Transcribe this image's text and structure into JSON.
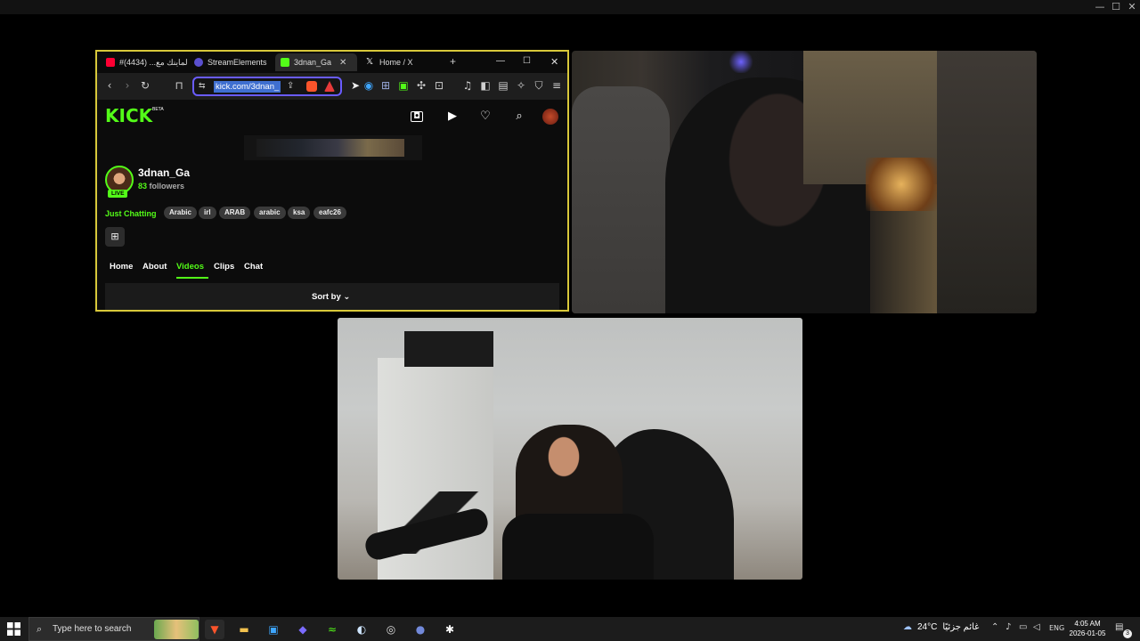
{
  "window": {
    "minimize": "—",
    "maximize": "☐",
    "close": "✕"
  },
  "browser": {
    "tabs": [
      {
        "label": "#الماينك مع... (4434)",
        "icon_color": "#ff0033",
        "icon": "youtube-icon"
      },
      {
        "label": "StreamElements",
        "icon_color": "#5a4fcf",
        "icon": "streamelements-icon"
      },
      {
        "label": "3dnan_Ga",
        "icon_color": "#53fc18",
        "icon": "kick-icon",
        "close": "✕"
      },
      {
        "label": "Home / X",
        "icon_color": "#ffffff",
        "icon": "x-icon"
      }
    ],
    "new_tab": "+",
    "controls": {
      "minimize": "—",
      "maximize": "☐",
      "close": "✕"
    },
    "url": "kick.com/3dnan_"
  },
  "kick": {
    "logo": "KICK",
    "beta": "BETA",
    "channel_name": "3dnan_Ga",
    "followers_count": "83",
    "followers_label": "followers",
    "live_badge": "LIVE",
    "category": "Just Chatting",
    "tags": [
      "Arabic",
      "irl",
      "ARAB",
      "arabic",
      "ksa",
      "eafc26"
    ],
    "subtabs": [
      "Home",
      "About",
      "Videos",
      "Clips",
      "Chat"
    ],
    "active_subtab": "Videos",
    "sort_label": "Sort by",
    "accent": "#53fc18"
  },
  "taskbar": {
    "search_placeholder": "Type here to search",
    "weather_temp": "24°C",
    "weather_text": "غائم جزئيًا",
    "language": "ENG",
    "time": "4:05 AM",
    "date": "2026-01-05",
    "notification_count": "3"
  }
}
